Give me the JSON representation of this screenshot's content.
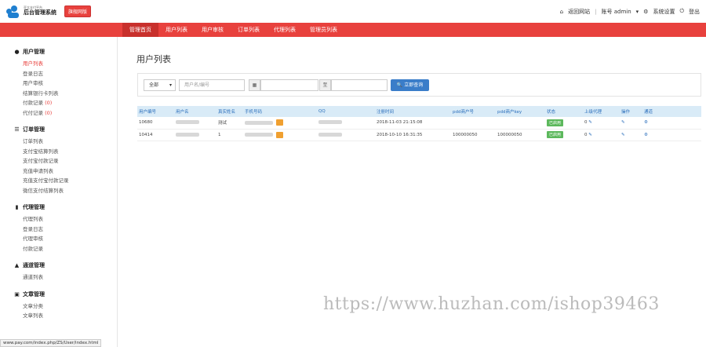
{
  "logo": {
    "small": "亚太支付平台",
    "big": "后台管理系统"
  },
  "version_badge": "旗舰网版",
  "top_right": {
    "back_site": "返回网站",
    "account": "账号 admin",
    "settings": "系统设置",
    "logout": "登出"
  },
  "nav": [
    "管理首页",
    "用户列表",
    "用户审核",
    "订单列表",
    "代理列表",
    "管理员列表"
  ],
  "sidebar": {
    "sections": [
      {
        "title": "用户管理",
        "icon": "user-icon",
        "items": [
          {
            "label": "用户列表"
          },
          {
            "label": "登录日志"
          },
          {
            "label": "用户审核"
          },
          {
            "label": "结算银行卡列表"
          },
          {
            "label": "付款记录",
            "count": "(0)"
          },
          {
            "label": "代付记录",
            "count": "(0)"
          }
        ]
      },
      {
        "title": "订单管理",
        "icon": "list-icon",
        "items": [
          {
            "label": "订单列表"
          },
          {
            "label": "支付宝结算列表"
          },
          {
            "label": "支付宝付款记录"
          },
          {
            "label": "充值申请列表"
          },
          {
            "label": "充值支付宝付款记录"
          },
          {
            "label": "微信支付结算列表"
          }
        ]
      },
      {
        "title": "代理管理",
        "icon": "file-icon",
        "items": [
          {
            "label": "代理列表"
          },
          {
            "label": "登录日志"
          },
          {
            "label": "代理审核"
          },
          {
            "label": "付款记录"
          }
        ]
      },
      {
        "title": "通道管理",
        "icon": "road-icon",
        "items": [
          {
            "label": "通道列表"
          }
        ]
      },
      {
        "title": "文章管理",
        "icon": "article-icon",
        "items": [
          {
            "label": "文章分类"
          },
          {
            "label": "文章列表"
          }
        ]
      }
    ]
  },
  "page_title": "用户列表",
  "search": {
    "select_value": "全部",
    "user_placeholder": "用户名/编号",
    "date_sep": "至",
    "button": "立即查询"
  },
  "table": {
    "headers": [
      "用户编号",
      "用户名",
      "真实姓名",
      "手机号码",
      "QQ",
      "注册时间",
      "pdd商户号",
      "pdd商户key",
      "状态",
      "上级代理",
      "操作",
      "通道"
    ],
    "rows": [
      {
        "id": "10680",
        "realname": "测试",
        "regtime": "2018-11-03 21:15:08",
        "pdd_id": "",
        "pdd_key": "",
        "status": "已启用",
        "agent": "0"
      },
      {
        "id": "10414",
        "realname": "1",
        "regtime": "2018-10-10 16:31:35",
        "pdd_id": "100000050",
        "pdd_key": "100000050",
        "status": "已启用",
        "agent": "0"
      }
    ]
  },
  "status_url": "www.pay.com/index.php/ZS/User/index.html",
  "watermark": "https://www.huzhan.com/ishop39463"
}
